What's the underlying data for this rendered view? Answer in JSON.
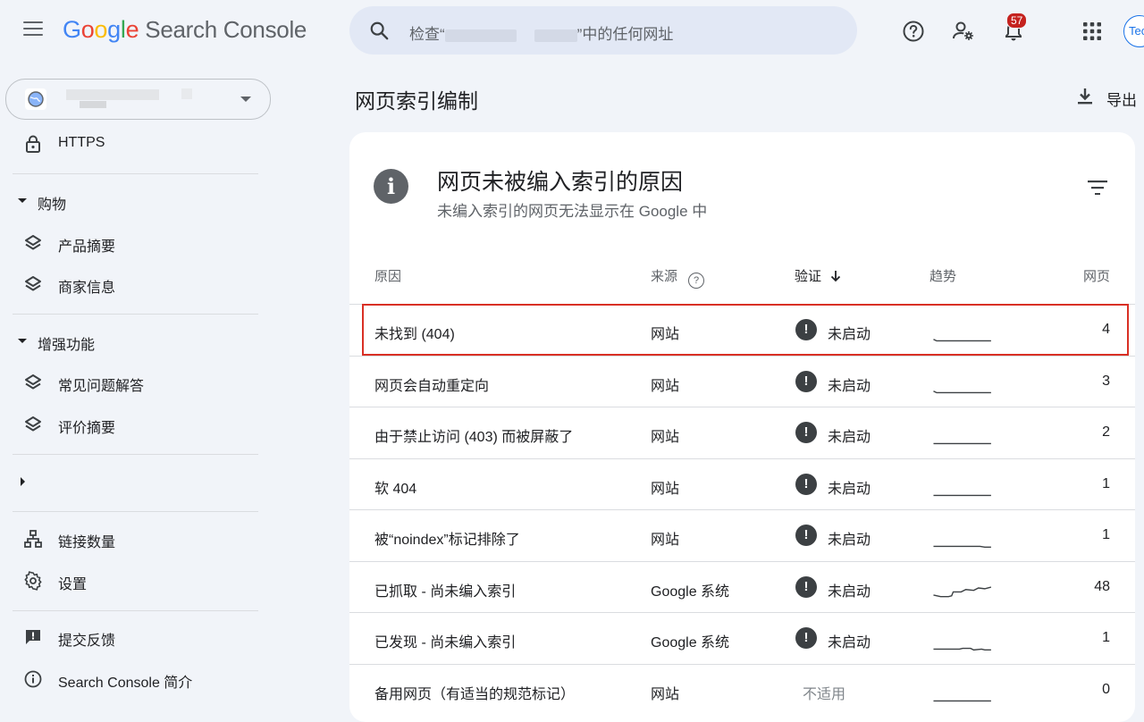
{
  "header": {
    "logo_google": [
      "G",
      "o",
      "o",
      "g",
      "l",
      "e"
    ],
    "logo_product": "Search Console",
    "search_prefix": "检查“",
    "search_suffix": "”中的任何网址",
    "notification_count": "57",
    "avatar_initials": "Tec"
  },
  "sidebar": {
    "https_label": "HTTPS",
    "shopping_section": "购物",
    "product_snippets": "产品摘要",
    "merchant_listings": "商家信息",
    "enhancements_section": "增强功能",
    "faq": "常见问题解答",
    "review_snippets": "评价摘要",
    "links": "链接数量",
    "settings": "设置",
    "feedback": "提交反馈",
    "about": "Search Console 简介"
  },
  "main": {
    "page_title": "网页索引编制",
    "export_label": "导出",
    "card_title": "网页未被编入索引的原因",
    "card_subtitle": "未编入索引的网页无法显示在 Google 中",
    "columns": {
      "reason": "原因",
      "source": "来源",
      "validation": "验证",
      "trend": "趋势",
      "pages": "网页"
    },
    "rows": [
      {
        "reason": "未找到 (404)",
        "source": "网站",
        "status": "未启动",
        "pages": "4",
        "highlighted": true
      },
      {
        "reason": "网页会自动重定向",
        "source": "网站",
        "status": "未启动",
        "pages": "3"
      },
      {
        "reason": "由于禁止访问 (403) 而被屏蔽了",
        "source": "网站",
        "status": "未启动",
        "pages": "2"
      },
      {
        "reason": "软 404",
        "source": "网站",
        "status": "未启动",
        "pages": "1"
      },
      {
        "reason": "被“noindex”标记排除了",
        "source": "网站",
        "status": "未启动",
        "pages": "1"
      },
      {
        "reason": "已抓取 - 尚未编入索引",
        "source": "Google 系统",
        "status": "未启动",
        "pages": "48"
      },
      {
        "reason": "已发现 - 尚未编入索引",
        "source": "Google 系统",
        "status": "未启动",
        "pages": "1"
      },
      {
        "reason": "备用网页（有适当的规范标记）",
        "source": "网站",
        "status": "不适用",
        "pages": "0"
      }
    ]
  }
}
